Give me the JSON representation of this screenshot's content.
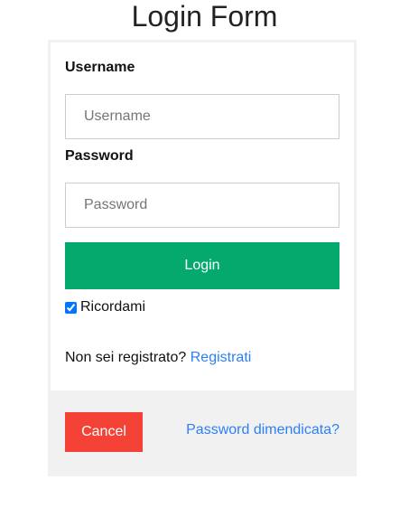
{
  "title": "Login Form",
  "username": {
    "label": "Username",
    "placeholder": "Username",
    "value": ""
  },
  "password": {
    "label": "Password",
    "placeholder": "Password",
    "value": ""
  },
  "login_label": "Login",
  "remember": {
    "label": "Ricordami",
    "checked": true
  },
  "register": {
    "text": "Non sei registrato? ",
    "link": "Registrati"
  },
  "cancel_label": "Cancel",
  "forgot_link": "Password dimendicata?",
  "colors": {
    "login": "#04AA6D",
    "cancel": "#f44336",
    "link": "#2d7ff9",
    "footer": "#f1f1f1"
  }
}
